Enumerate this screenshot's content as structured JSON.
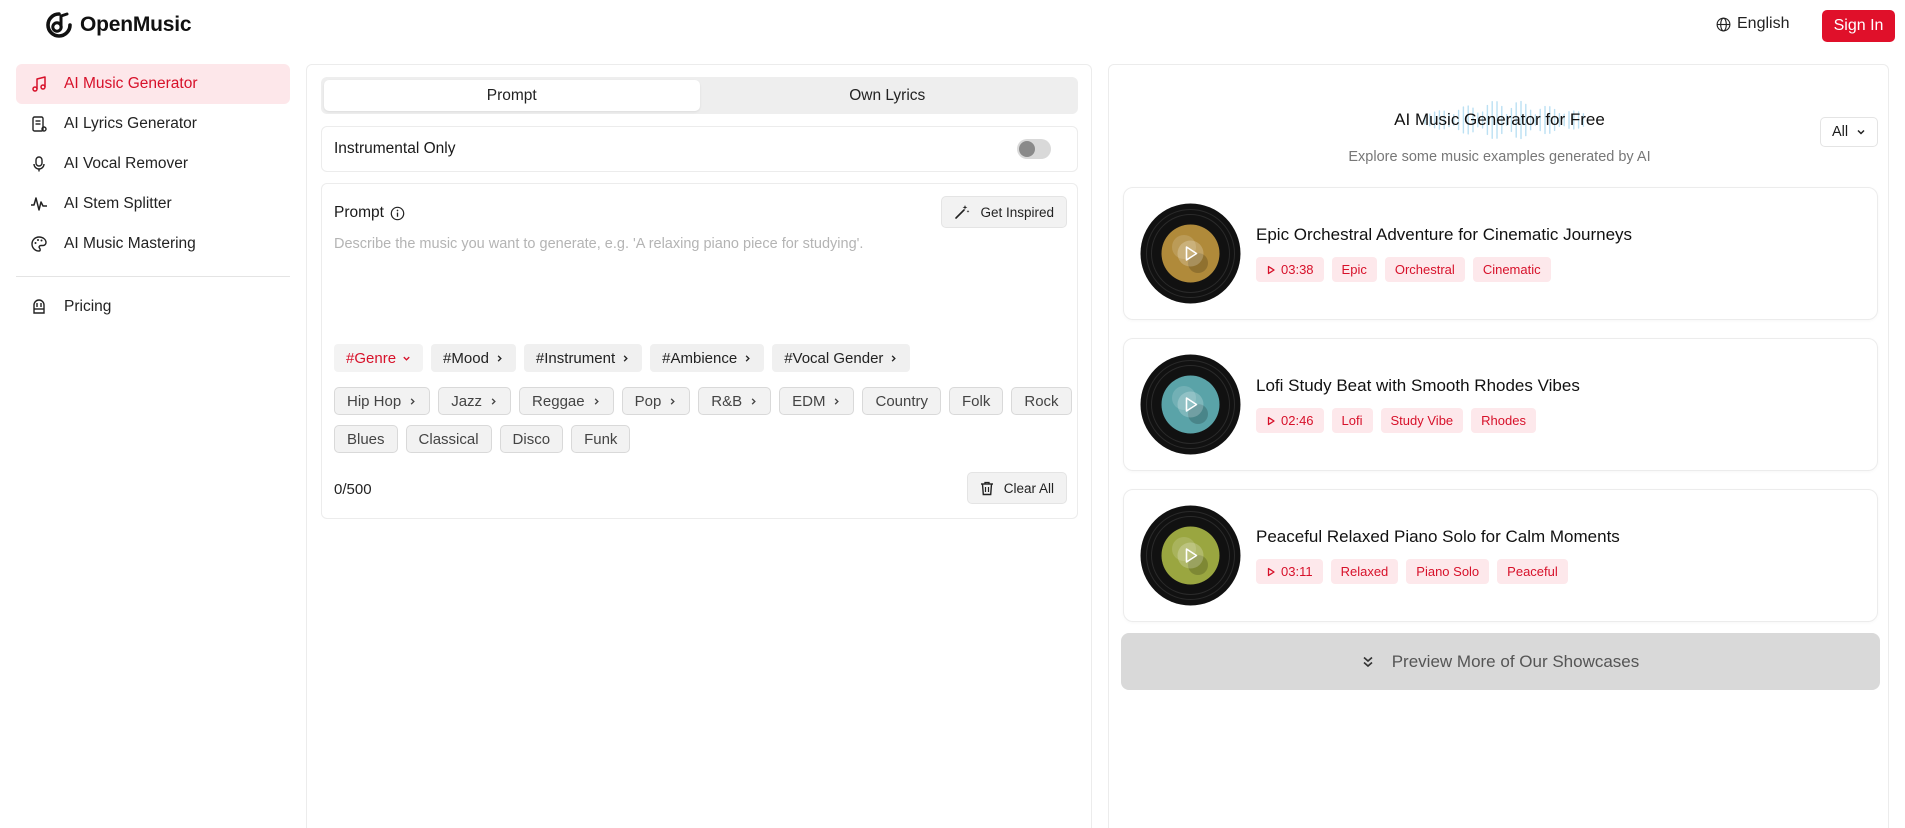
{
  "header": {
    "brand": "OpenMusic",
    "language": "English",
    "signin_label": "Sign In"
  },
  "sidebar": {
    "items": [
      {
        "label": "AI Music Generator",
        "icon": "music-note-icon",
        "active": true
      },
      {
        "label": "AI Lyrics Generator",
        "icon": "lyrics-doc-icon"
      },
      {
        "label": "AI Vocal Remover",
        "icon": "microphone-icon"
      },
      {
        "label": "AI Stem Splitter",
        "icon": "waveform-icon"
      },
      {
        "label": "AI Music Mastering",
        "icon": "palette-icon"
      }
    ],
    "pricing_label": "Pricing"
  },
  "generator": {
    "tabs": [
      "Prompt",
      "Own Lyrics"
    ],
    "active_tab": "Prompt",
    "instrumental_label": "Instrumental Only",
    "instrumental_on": false,
    "prompt_label": "Prompt",
    "get_inspired_label": "Get Inspired",
    "prompt_placeholder": "Describe the music you want to generate, e.g. 'A relaxing piano piece for studying'.",
    "prompt_value": "",
    "categories": [
      "#Genre",
      "#Mood",
      "#Instrument",
      "#Ambience",
      "#Vocal Gender"
    ],
    "active_category": "#Genre",
    "genres": [
      {
        "label": "Hip Hop",
        "expandable": true
      },
      {
        "label": "Jazz",
        "expandable": true
      },
      {
        "label": "Reggae",
        "expandable": true
      },
      {
        "label": "Pop",
        "expandable": true
      },
      {
        "label": "R&B",
        "expandable": true
      },
      {
        "label": "EDM",
        "expandable": true
      },
      {
        "label": "Country",
        "expandable": false
      },
      {
        "label": "Folk",
        "expandable": false
      },
      {
        "label": "Rock",
        "expandable": false
      },
      {
        "label": "Blues",
        "expandable": false
      },
      {
        "label": "Classical",
        "expandable": false
      },
      {
        "label": "Disco",
        "expandable": false
      },
      {
        "label": "Funk",
        "expandable": false
      }
    ],
    "counter": "0/500",
    "clear_label": "Clear All"
  },
  "showcase": {
    "title": "AI Music Generator for Free",
    "subtitle": "Explore some music examples generated by AI",
    "filter_value": "All",
    "tracks": [
      {
        "title": "Epic Orchestral Adventure for Cinematic Journeys",
        "duration": "03:38",
        "tags": [
          "Epic",
          "Orchestral",
          "Cinematic"
        ],
        "cover_color": "#b08a3a"
      },
      {
        "title": "Lofi Study Beat with Smooth Rhodes Vibes",
        "duration": "02:46",
        "tags": [
          "Lofi",
          "Study Vibe",
          "Rhodes"
        ],
        "cover_color": "#5aa3a8"
      },
      {
        "title": "Peaceful Relaxed Piano Solo for Calm Moments",
        "duration": "03:11",
        "tags": [
          "Relaxed",
          "Piano Solo",
          "Peaceful"
        ],
        "cover_color": "#9aa640"
      }
    ],
    "more_label": "Preview More of Our Showcases"
  },
  "colors": {
    "accent": "#e0102a",
    "accent_soft": "#fde7ea"
  }
}
